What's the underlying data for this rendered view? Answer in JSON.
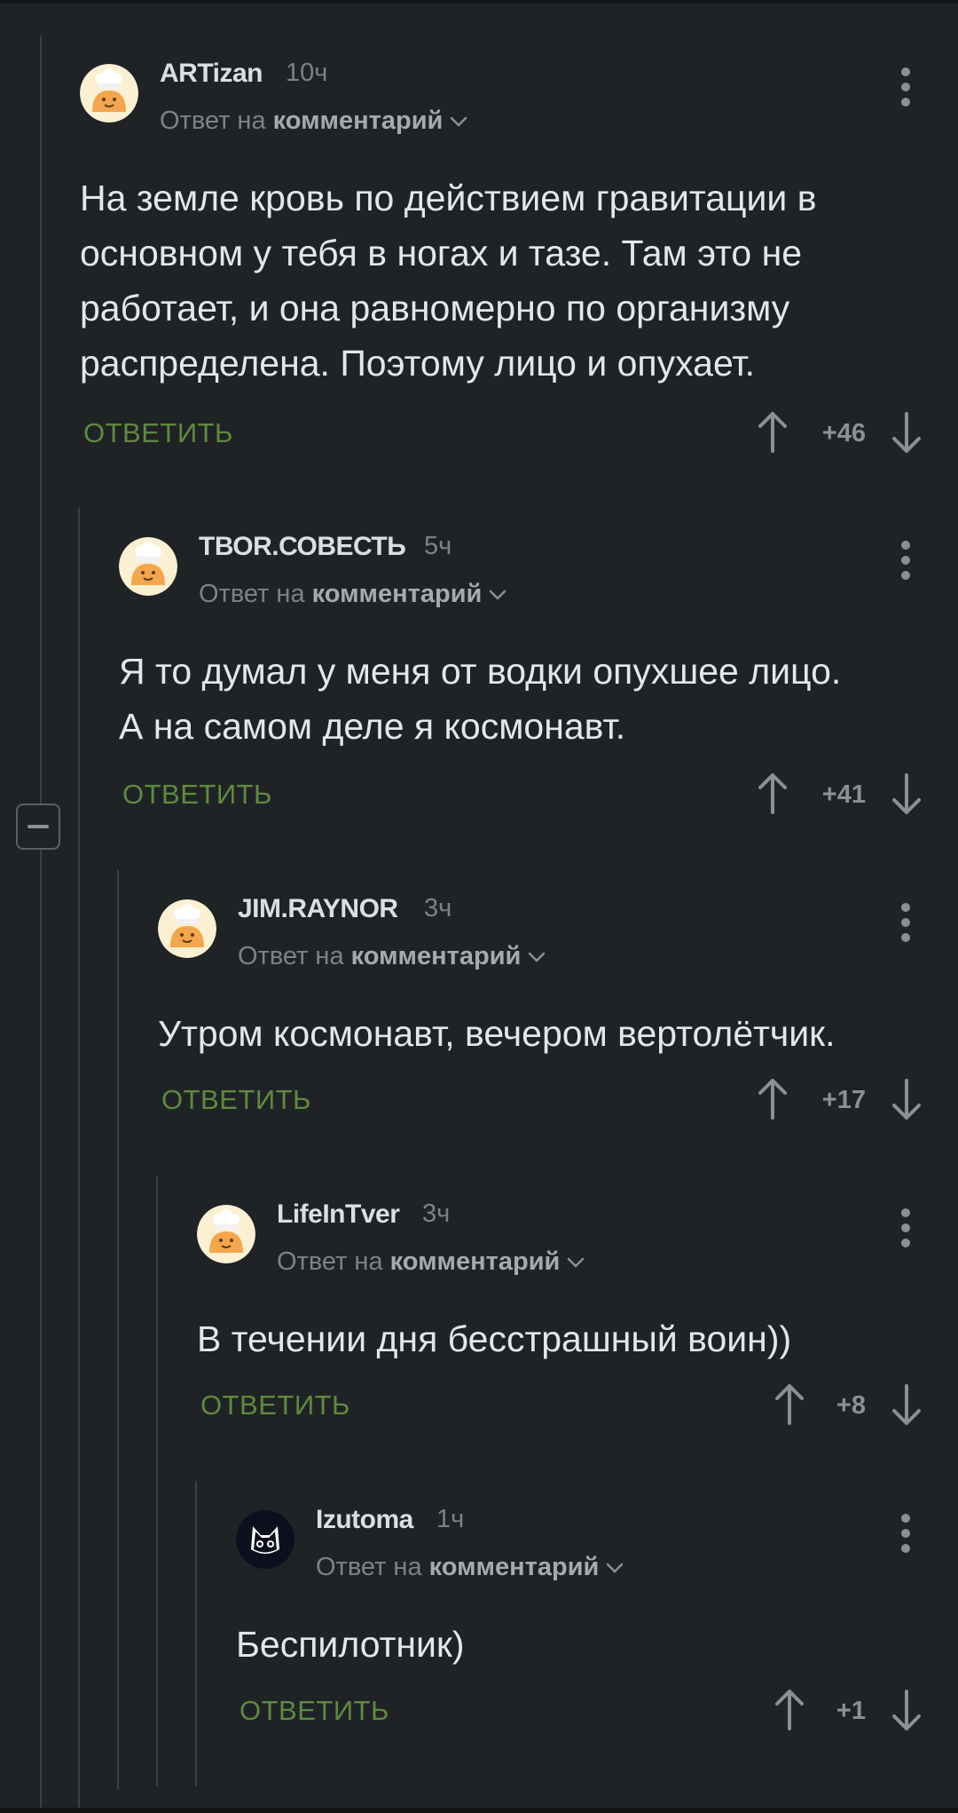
{
  "colors": {
    "background": "#1f2326",
    "reply_green": "#5f8a3e",
    "muted": "#7d8287",
    "username": "#dcdfe2"
  },
  "reply_prefix": "Ответ на",
  "reply_target": "комментарий",
  "comments": [
    {
      "username": "ARTizan",
      "time": "10ч",
      "text_lines": [
        "На земле кровь по действием гравитации в",
        "основном у тебя в ногах и тазе. Там это не",
        "работает, и она равномерно по организму",
        "распределена. Поэтому лицо и опухает."
      ],
      "reply_label": "ОТВЕТИТЬ",
      "score": "+46",
      "avatar": "chef-avatar"
    },
    {
      "username": "ТВОR.СОВЕСТЬ",
      "time": "5ч",
      "text_lines": [
        "Я то думал у меня от водки опухшее лицо.",
        "А на самом деле я космонавт."
      ],
      "reply_label": "ОТВЕТИТЬ",
      "score": "+41",
      "avatar": "chef-avatar"
    },
    {
      "username": "JIM.RAYNOR",
      "time": "3ч",
      "text_lines": [
        "Утром космонавт, вечером вертолётчик."
      ],
      "reply_label": "ОТВЕТИТЬ",
      "score": "+17",
      "avatar": "chef-avatar"
    },
    {
      "username": "LifeInTver",
      "time": "3ч",
      "text_lines": [
        "В течении дня бесстрашный воин))"
      ],
      "reply_label": "ОТВЕТИТЬ",
      "score": "+8",
      "avatar": "chef-avatar"
    },
    {
      "username": "Izutoma",
      "time": "1ч",
      "text_lines": [
        "Беспилотник)"
      ],
      "reply_label": "ОТВЕТИТЬ",
      "score": "+1",
      "avatar": "cat-avatar"
    }
  ]
}
